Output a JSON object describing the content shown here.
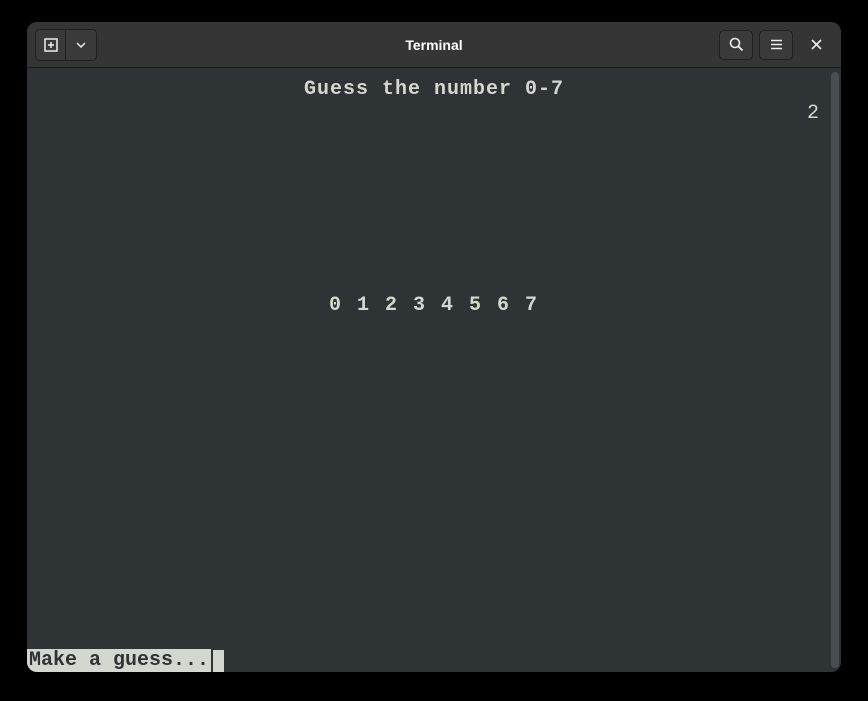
{
  "window": {
    "title": "Terminal"
  },
  "game": {
    "title": "Guess the number 0-7",
    "counter": "2",
    "numbers": "0 1 2 3 4 5 6 7",
    "prompt": "Make a guess..."
  }
}
